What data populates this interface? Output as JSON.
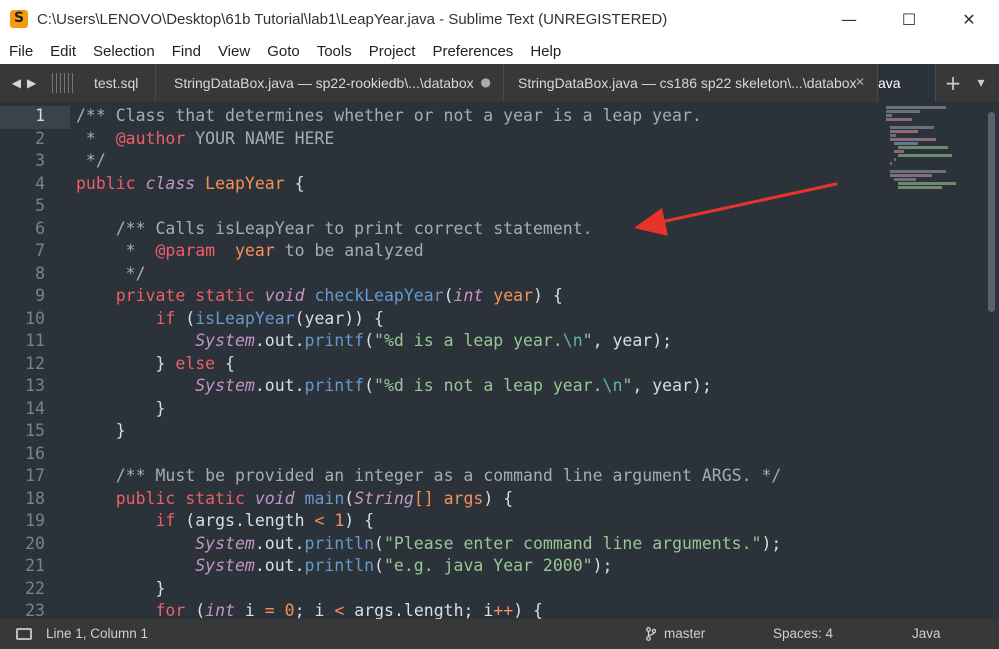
{
  "window": {
    "title": "C:\\Users\\LENOVO\\Desktop\\61b Tutorial\\lab1\\LeapYear.java - Sublime Text (UNREGISTERED)",
    "app_icon": "sublime-text-icon",
    "controls": {
      "minimize": "—",
      "maximize": "☐",
      "close": "✕"
    }
  },
  "menu": [
    "File",
    "Edit",
    "Selection",
    "Find",
    "View",
    "Goto",
    "Tools",
    "Project",
    "Preferences",
    "Help"
  ],
  "tabs": [
    {
      "label": "test.sql",
      "close": ""
    },
    {
      "label": "StringDataBox.java — sp22-rookiedb\\...\\databox",
      "close": "●"
    },
    {
      "label": "StringDataBox.java — cs186 sp22 skeleton\\...\\databox",
      "close": "✕"
    },
    {
      "label": "ava",
      "close": ""
    }
  ],
  "tab_nav": {
    "back": "◀",
    "forward": "▶",
    "new_tab": "+",
    "tab_list": "▾"
  },
  "editor": {
    "current_line": 1,
    "line_numbers": [
      "1",
      "2",
      "3",
      "4",
      "5",
      "6",
      "7",
      "8",
      "9",
      "10",
      "11",
      "12",
      "13",
      "14",
      "15",
      "16",
      "17",
      "18",
      "19",
      "20",
      "21",
      "22",
      "23"
    ],
    "lines": [
      [
        [
          "c-comment",
          "/** Class that determines whether or not a year is a leap year."
        ]
      ],
      [
        [
          "c-comment",
          " *  "
        ],
        [
          "c-tag",
          "@author"
        ],
        [
          "c-comment",
          " YOUR NAME HERE"
        ]
      ],
      [
        [
          "c-comment",
          " */"
        ]
      ],
      [
        [
          "c-kw",
          "public"
        ],
        [
          "c-plain",
          " "
        ],
        [
          "c-type",
          "class"
        ],
        [
          "c-plain",
          " "
        ],
        [
          "c-class",
          "LeapYear"
        ],
        [
          "c-plain",
          " {"
        ]
      ],
      [
        [
          "c-plain",
          ""
        ]
      ],
      [
        [
          "c-plain",
          "    "
        ],
        [
          "c-comment",
          "/** Calls isLeapYear to print correct statement."
        ]
      ],
      [
        [
          "c-comment",
          "     *  "
        ],
        [
          "c-tag",
          "@param"
        ],
        [
          "c-comment",
          "  "
        ],
        [
          "c-param",
          "year"
        ],
        [
          "c-comment",
          " to be analyzed"
        ]
      ],
      [
        [
          "c-comment",
          "     */"
        ]
      ],
      [
        [
          "c-plain",
          "    "
        ],
        [
          "c-kw",
          "private static"
        ],
        [
          "c-plain",
          " "
        ],
        [
          "c-type",
          "void"
        ],
        [
          "c-plain",
          " "
        ],
        [
          "c-func",
          "checkLeapYear"
        ],
        [
          "c-plain",
          "("
        ],
        [
          "c-type",
          "int"
        ],
        [
          "c-plain",
          " "
        ],
        [
          "c-param",
          "year"
        ],
        [
          "c-plain",
          ") {"
        ]
      ],
      [
        [
          "c-plain",
          "        "
        ],
        [
          "c-kw",
          "if"
        ],
        [
          "c-plain",
          " ("
        ],
        [
          "c-func",
          "isLeapYear"
        ],
        [
          "c-plain",
          "(year)) {"
        ]
      ],
      [
        [
          "c-plain",
          "            "
        ],
        [
          "c-sys",
          "System"
        ],
        [
          "c-plain",
          ".out."
        ],
        [
          "c-func",
          "printf"
        ],
        [
          "c-plain",
          "("
        ],
        [
          "c-str",
          "\"%d is a leap year."
        ],
        [
          "c-esc",
          "\\n"
        ],
        [
          "c-str",
          "\""
        ],
        [
          "c-plain",
          ", year);"
        ]
      ],
      [
        [
          "c-plain",
          "        } "
        ],
        [
          "c-kw",
          "else"
        ],
        [
          "c-plain",
          " {"
        ]
      ],
      [
        [
          "c-plain",
          "            "
        ],
        [
          "c-sys",
          "System"
        ],
        [
          "c-plain",
          ".out."
        ],
        [
          "c-func",
          "printf"
        ],
        [
          "c-plain",
          "("
        ],
        [
          "c-str",
          "\"%d is not a leap year."
        ],
        [
          "c-esc",
          "\\n"
        ],
        [
          "c-str",
          "\""
        ],
        [
          "c-plain",
          ", year);"
        ]
      ],
      [
        [
          "c-plain",
          "        }"
        ]
      ],
      [
        [
          "c-plain",
          "    }"
        ]
      ],
      [
        [
          "c-plain",
          ""
        ]
      ],
      [
        [
          "c-plain",
          "    "
        ],
        [
          "c-comment",
          "/** Must be provided an integer as a command line argument ARGS. */"
        ]
      ],
      [
        [
          "c-plain",
          "    "
        ],
        [
          "c-kw",
          "public static"
        ],
        [
          "c-plain",
          " "
        ],
        [
          "c-type",
          "void"
        ],
        [
          "c-plain",
          " "
        ],
        [
          "c-func",
          "main"
        ],
        [
          "c-plain",
          "("
        ],
        [
          "c-type",
          "String"
        ],
        [
          "c-op",
          "[]"
        ],
        [
          "c-plain",
          " "
        ],
        [
          "c-param",
          "args"
        ],
        [
          "c-plain",
          ") {"
        ]
      ],
      [
        [
          "c-plain",
          "        "
        ],
        [
          "c-kw",
          "if"
        ],
        [
          "c-plain",
          " (args.length "
        ],
        [
          "c-op",
          "<"
        ],
        [
          "c-plain",
          " "
        ],
        [
          "c-num",
          "1"
        ],
        [
          "c-plain",
          ") {"
        ]
      ],
      [
        [
          "c-plain",
          "            "
        ],
        [
          "c-sys",
          "System"
        ],
        [
          "c-plain",
          ".out."
        ],
        [
          "c-func",
          "println"
        ],
        [
          "c-plain",
          "("
        ],
        [
          "c-str",
          "\"Please enter command line arguments.\""
        ],
        [
          "c-plain",
          ");"
        ]
      ],
      [
        [
          "c-plain",
          "            "
        ],
        [
          "c-sys",
          "System"
        ],
        [
          "c-plain",
          ".out."
        ],
        [
          "c-func",
          "println"
        ],
        [
          "c-plain",
          "("
        ],
        [
          "c-str",
          "\"e.g. java Year 2000\""
        ],
        [
          "c-plain",
          ");"
        ]
      ],
      [
        [
          "c-plain",
          "        }"
        ]
      ],
      [
        [
          "c-plain",
          "        "
        ],
        [
          "c-kw",
          "for"
        ],
        [
          "c-plain",
          " ("
        ],
        [
          "c-type",
          "int"
        ],
        [
          "c-plain",
          " i "
        ],
        [
          "c-op",
          "="
        ],
        [
          "c-plain",
          " "
        ],
        [
          "c-num",
          "0"
        ],
        [
          "c-plain",
          "; i "
        ],
        [
          "c-op",
          "<"
        ],
        [
          "c-plain",
          " args.length; i"
        ],
        [
          "c-op",
          "++"
        ],
        [
          "c-plain",
          ") {"
        ]
      ]
    ]
  },
  "annotation_arrow": {
    "color": "#e8322c"
  },
  "status": {
    "position": "Line 1, Column 1",
    "branch": "master",
    "branch_icon": "git-branch-icon",
    "indent": "Spaces: 4",
    "syntax": "Java"
  }
}
